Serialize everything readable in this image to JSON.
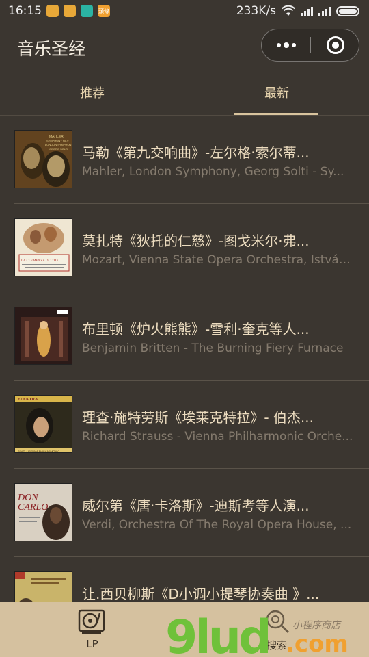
{
  "status_bar": {
    "time": "16:15",
    "network_speed": "233K/s",
    "notification_icons": [
      "#e8a838",
      "#e8a838",
      "#2bb3a3",
      "#f0a030"
    ],
    "notif_badge_text": "頭條"
  },
  "header": {
    "title": "音乐圣经"
  },
  "tabs": [
    {
      "label": "推荐",
      "active": false
    },
    {
      "label": "最新",
      "active": true
    }
  ],
  "items": [
    {
      "title": "马勒《第九交响曲》-左尔格·索尔蒂...",
      "subtitle": "Mahler, London Symphony, Georg Solti  -  Sy...",
      "cover": {
        "bg": "#5a3d1c",
        "accent": "#cfa64a",
        "text_lines": [
          "MAHLER",
          "SYMPHONY No.9",
          "LONDON SYMPHONY",
          "GEORG SOLTI"
        ]
      }
    },
    {
      "title": "莫扎特《狄托的仁慈》-图戈米尔·弗...",
      "subtitle": "Mozart, Vienna State Opera Orchestra, István...",
      "cover": {
        "bg": "#efe6d2",
        "accent": "#b0322a",
        "text_lines": [
          "LA CLEMENZA DI TITO"
        ]
      }
    },
    {
      "title": "布里顿《炉火熊熊》-雪利·奎克等人...",
      "subtitle": "Benjamin Britten  -  The Burning Fiery Furnace",
      "cover": {
        "bg": "#2a1a18",
        "accent": "#d9b67a",
        "text_lines": []
      }
    },
    {
      "title": "理查·施特劳斯《埃莱克特拉》- 伯杰...",
      "subtitle": "Richard Strauss - Vienna Philharmonic Orche...",
      "cover": {
        "bg": "#2e2a1c",
        "accent": "#d8b54a",
        "text_lines": [
          "ELEKTRA",
          "SOLTI · VIENNA PHILHARMONIC"
        ]
      }
    },
    {
      "title": "威尔第《唐·卡洛斯》-迪斯考等人演...",
      "subtitle": "Verdi, Orchestra Of The Royal Opera House, ...",
      "cover": {
        "bg": "#d9d0c2",
        "accent": "#8a1f22",
        "text_lines": [
          "DON",
          "CARLO"
        ]
      }
    },
    {
      "title": "让.西贝柳斯《D小调小提琴协奏曲 》...",
      "subtitle": "",
      "cover": {
        "bg": "#c9b46a",
        "accent": "#b03a2a",
        "text_lines": []
      }
    }
  ],
  "tabbar": {
    "items": [
      {
        "label": "LP",
        "icon": "record-player-icon"
      },
      {
        "label": "搜索",
        "icon": "search-icon"
      }
    ]
  },
  "watermark": {
    "brand": "9lud",
    "domain": ".com",
    "tagline": "小程序商店"
  }
}
